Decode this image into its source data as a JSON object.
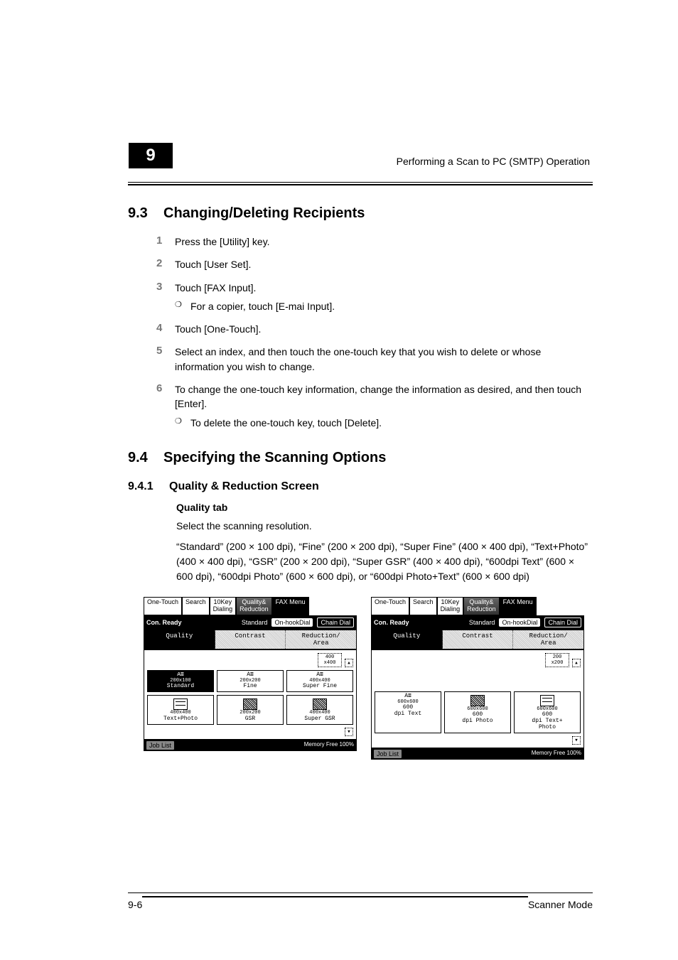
{
  "chapter_number": "9",
  "running_head": "Performing a Scan to PC (SMTP) Operation",
  "sections": {
    "s93": {
      "number": "9.3",
      "title": "Changing/Deleting Recipients",
      "steps": [
        {
          "n": "1",
          "text": "Press the [Utility] key."
        },
        {
          "n": "2",
          "text": "Touch [User Set]."
        },
        {
          "n": "3",
          "text": "Touch [FAX Input].",
          "sub": [
            "For a copier, touch [E-mai Input]."
          ]
        },
        {
          "n": "4",
          "text": "Touch [One-Touch]."
        },
        {
          "n": "5",
          "text": "Select an index, and then touch the one-touch key that you wish to delete or whose information you wish to change."
        },
        {
          "n": "6",
          "text": "To change the one-touch key information, change the information as desired, and then touch [Enter].",
          "sub": [
            "To delete the one-touch key, touch [Delete]."
          ]
        }
      ]
    },
    "s94": {
      "number": "9.4",
      "title": "Specifying the Scanning Options",
      "sub1": {
        "number": "9.4.1",
        "title": "Quality & Reduction Screen",
        "heading": "Quality tab",
        "intro": "Select the scanning resolution.",
        "resolutions": "“Standard” (200 × 100 dpi), “Fine” (200 × 200 dpi), “Super Fine” (400 × 400 dpi), “Text+Photo” (400 × 400 dpi), “GSR” (200 × 200 dpi), “Super GSR” (400 × 400 dpi), “600dpi Text” (600 × 600 dpi), “600dpi Photo” (600 × 600 dpi), or “600dpi Photo+Text” (600 × 600 dpi)"
      }
    }
  },
  "lcd": {
    "tabs": [
      {
        "label": "One-Touch"
      },
      {
        "label": "Search"
      },
      {
        "label": "10Key\nDialing"
      },
      {
        "label": "Quality&\nReduction"
      },
      {
        "label": "FAX Menu"
      }
    ],
    "status_left": "Con. Ready",
    "status_mid": "Standard",
    "pills": [
      "On-hookDial",
      "Chain Dial"
    ],
    "subtabs": [
      "Quality",
      "Contrast",
      "Reduction/\nArea"
    ],
    "page1": {
      "ratio_label": "400\nx400",
      "row1": [
        {
          "tiny": "200x100",
          "label": "Standard",
          "black": true
        },
        {
          "tiny": "200x200",
          "label": "Fine"
        },
        {
          "tiny": "400x400",
          "label": "Super Fine"
        }
      ],
      "row2": [
        {
          "tiny": "400x400",
          "label": "Text+Photo"
        },
        {
          "tiny": "200x200",
          "label": "GSR"
        },
        {
          "tiny": "400x400",
          "label": "Super GSR"
        }
      ]
    },
    "page2": {
      "ratio_label": "200\nx200",
      "row1": [
        {
          "tiny": "600x600",
          "label": "600\ndpi Text"
        },
        {
          "tiny": "600x600",
          "label": "600\ndpi Photo"
        },
        {
          "tiny": "600x600",
          "label": "600\ndpi Text+\nPhoto"
        }
      ]
    },
    "bottom": {
      "job_list": "Job List",
      "memory": "Memory Free 100%"
    }
  },
  "footer": {
    "page_number": "9-6",
    "doc_title": "Scanner Mode"
  }
}
